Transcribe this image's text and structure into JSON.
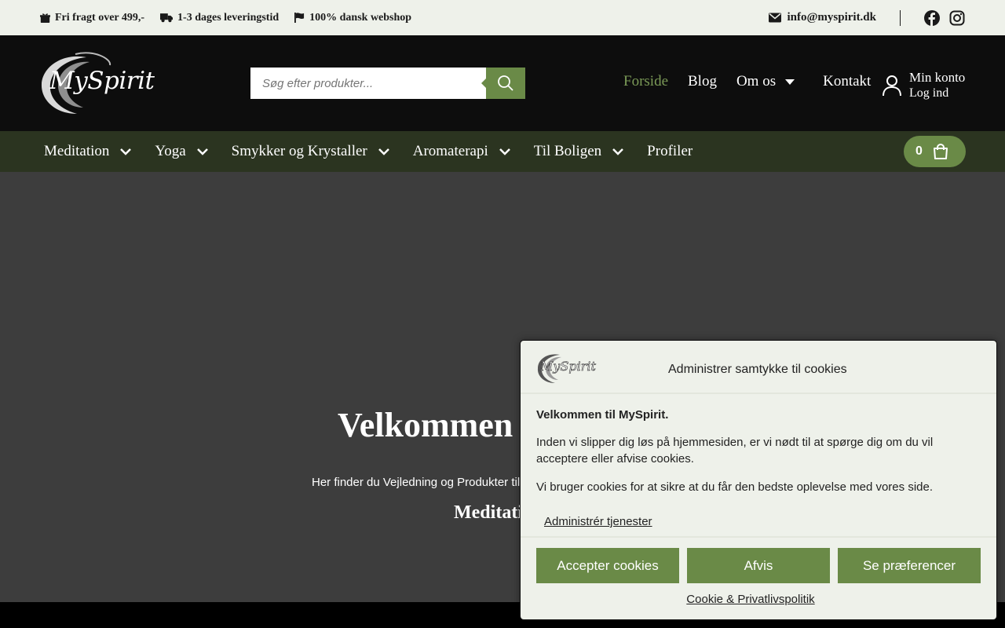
{
  "topbar": {
    "items": [
      {
        "icon": "gift-icon",
        "label": "Fri fragt over 499,-"
      },
      {
        "icon": "truck-icon",
        "label": "1-3 dages leveringstid"
      },
      {
        "icon": "flag-icon",
        "label": "100% dansk webshop"
      }
    ],
    "email": "info@myspirit.dk",
    "social": [
      "facebook-icon",
      "instagram-icon"
    ]
  },
  "header": {
    "logo_text": "MySpirit",
    "search_placeholder": "Søg efter produkter...",
    "nav": [
      {
        "label": "Forside",
        "active": true
      },
      {
        "label": "Blog"
      },
      {
        "label": "Om os",
        "dropdown": true
      },
      {
        "label": "Kontakt"
      }
    ],
    "account": {
      "title": "Min konto",
      "subtitle": "Log ind"
    }
  },
  "categories": [
    {
      "label": "Meditation",
      "dropdown": true
    },
    {
      "label": "Yoga",
      "dropdown": true
    },
    {
      "label": "Smykker og Krystaller",
      "dropdown": true
    },
    {
      "label": "Aromaterapi",
      "dropdown": true
    },
    {
      "label": "Til Boligen",
      "dropdown": true
    },
    {
      "label": "Profiler",
      "dropdown": false
    }
  ],
  "cart": {
    "count": "0"
  },
  "hero": {
    "title": "Velkommen t",
    "subtitle": "Her finder du Vejledning og Produkter til",
    "subtitle2": "Meditati"
  },
  "cookie": {
    "logo_text": "MySpirit",
    "title": "Administrer samtykke til cookies",
    "heading": "Velkommen til MySpirit.",
    "para1": "Inden vi slipper dig løs på hjemmesiden, er vi nødt til at spørge dig om du vil acceptere eller afvise cookies.",
    "para2": "Vi bruger cookies for at sikre at du får den bedste oplevelse med vores side.",
    "manage_link": "Administrér tjenester",
    "buttons": {
      "accept": "Accepter cookies",
      "deny": "Afvis",
      "preferences": "Se præferencer"
    },
    "policy_link": "Cookie & Privatlivspolitik"
  },
  "colors": {
    "accent": "#6a8a47",
    "catnav_bg": "#2b3420",
    "header_bg": "#0d0d0d",
    "topbar_bg": "#eef1ea",
    "hero_bg": "#3d3d3d"
  }
}
